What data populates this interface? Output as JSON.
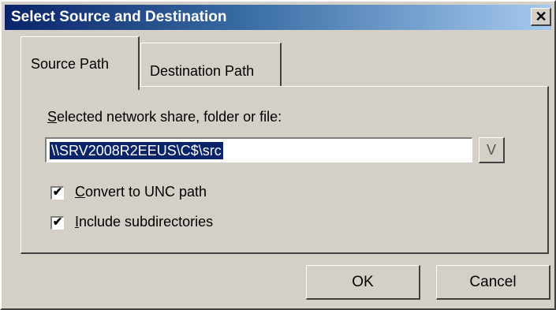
{
  "window": {
    "title": "Select Source and Destination",
    "close_glyph": "✕"
  },
  "tabs": [
    {
      "label": "Source Path",
      "selected": true
    },
    {
      "label": "Destination Path",
      "selected": false
    }
  ],
  "source": {
    "field_label_accel": "S",
    "field_label_rest": "elected network share, folder or file:",
    "path_value": "\\\\SRV2008R2EEUS\\C$\\src",
    "browse_label": "V"
  },
  "options": [
    {
      "accel": "C",
      "rest": "onvert to UNC path",
      "checked": true
    },
    {
      "accel": "I",
      "rest": "nclude subdirectories",
      "checked": true
    }
  ],
  "checkmark_glyph": "✔",
  "buttons": {
    "ok": "OK",
    "cancel": "Cancel"
  },
  "colors": {
    "titlebar_start": "#0a246a",
    "titlebar_end": "#a6caf0",
    "selection": "#0a246a",
    "face": "#d4d0c8"
  }
}
